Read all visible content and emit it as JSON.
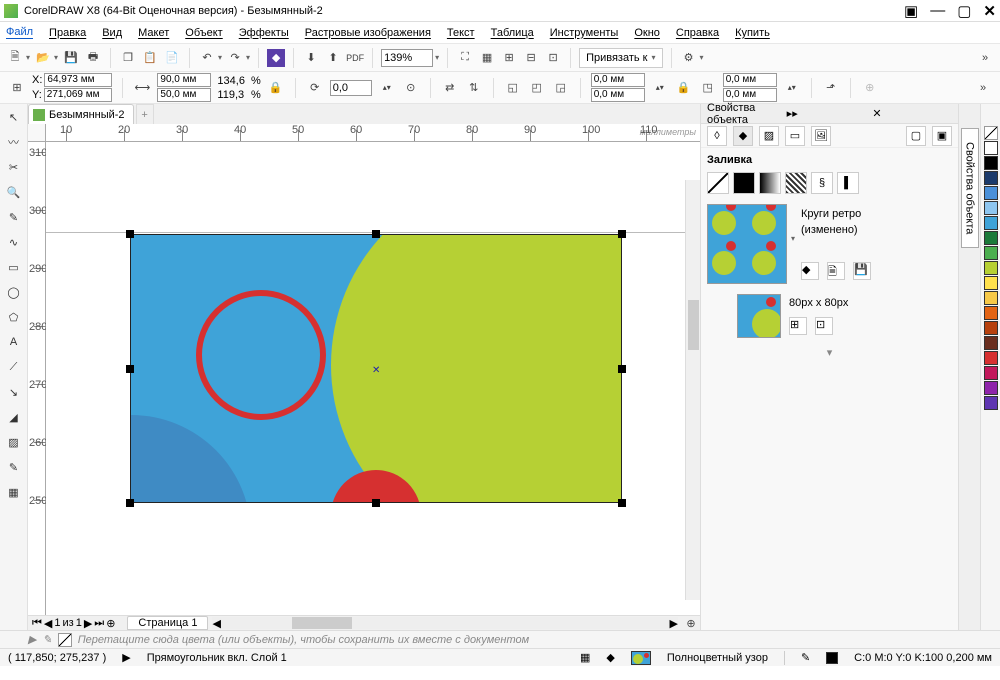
{
  "title": "CorelDRAW X8 (64-Bit Оценочная версия) - Безымянный-2",
  "menu": [
    "Файл",
    "Правка",
    "Вид",
    "Макет",
    "Объект",
    "Эффекты",
    "Растровые изображения",
    "Текст",
    "Таблица",
    "Инструменты",
    "Окно",
    "Справка",
    "Купить"
  ],
  "toolbar": {
    "zoom": "139%",
    "snap_label": "Привязать к"
  },
  "propbar": {
    "x_label": "X:",
    "y_label": "Y:",
    "x": "64,973 мм",
    "y": "271,069 мм",
    "w": "90,0 мм",
    "h": "50,0 мм",
    "sx": "134,6",
    "sy": "119,3",
    "pct": "%",
    "rot": "0,0",
    "outline_w": "0,0 мм",
    "outline_h": "0,0 мм",
    "corner_r1": "0,0 мм",
    "corner_r2": "0,0 мм"
  },
  "doc_tab": "Безымянный-2",
  "ruler_units": "миллиметры",
  "ruler_h_ticks": [
    10,
    20,
    30,
    40,
    50,
    60,
    70,
    80,
    90,
    100,
    110
  ],
  "ruler_v_ticks": [
    310,
    300,
    290,
    280,
    270,
    260,
    250
  ],
  "page_nav": {
    "pos": "1",
    "of_label": "из",
    "total": "1",
    "page_tab": "Страница 1"
  },
  "docker": {
    "title": "Свойства объекта",
    "fill_section": "Заливка",
    "pattern_name": "Круги ретро",
    "pattern_status": "(изменено)",
    "tile_size": "80px x 80px",
    "side_tab": "Свойства объекта"
  },
  "colors": [
    "#ffffff",
    "#000000",
    "#1b3a6b",
    "#4a90d9",
    "#8ec6f0",
    "#3fa3d8",
    "#1b7a3a",
    "#4caf50",
    "#b6d034",
    "#ffe14d",
    "#f7c948",
    "#e36414",
    "#b7410e",
    "#6a2e1f",
    "#d63030",
    "#c2185b",
    "#8e24aa",
    "#5e35b1"
  ],
  "wells_hint": "Перетащите сюда цвета (или объекты), чтобы сохранить их вместе с документом",
  "status": {
    "coords": "( 117,850; 275,237 )",
    "sel": "Прямоугольник вкл. Слой 1",
    "fill_name": "Полноцветный узор",
    "outline_info": "C:0 M:0 Y:0 K:100 0,200 мм"
  }
}
